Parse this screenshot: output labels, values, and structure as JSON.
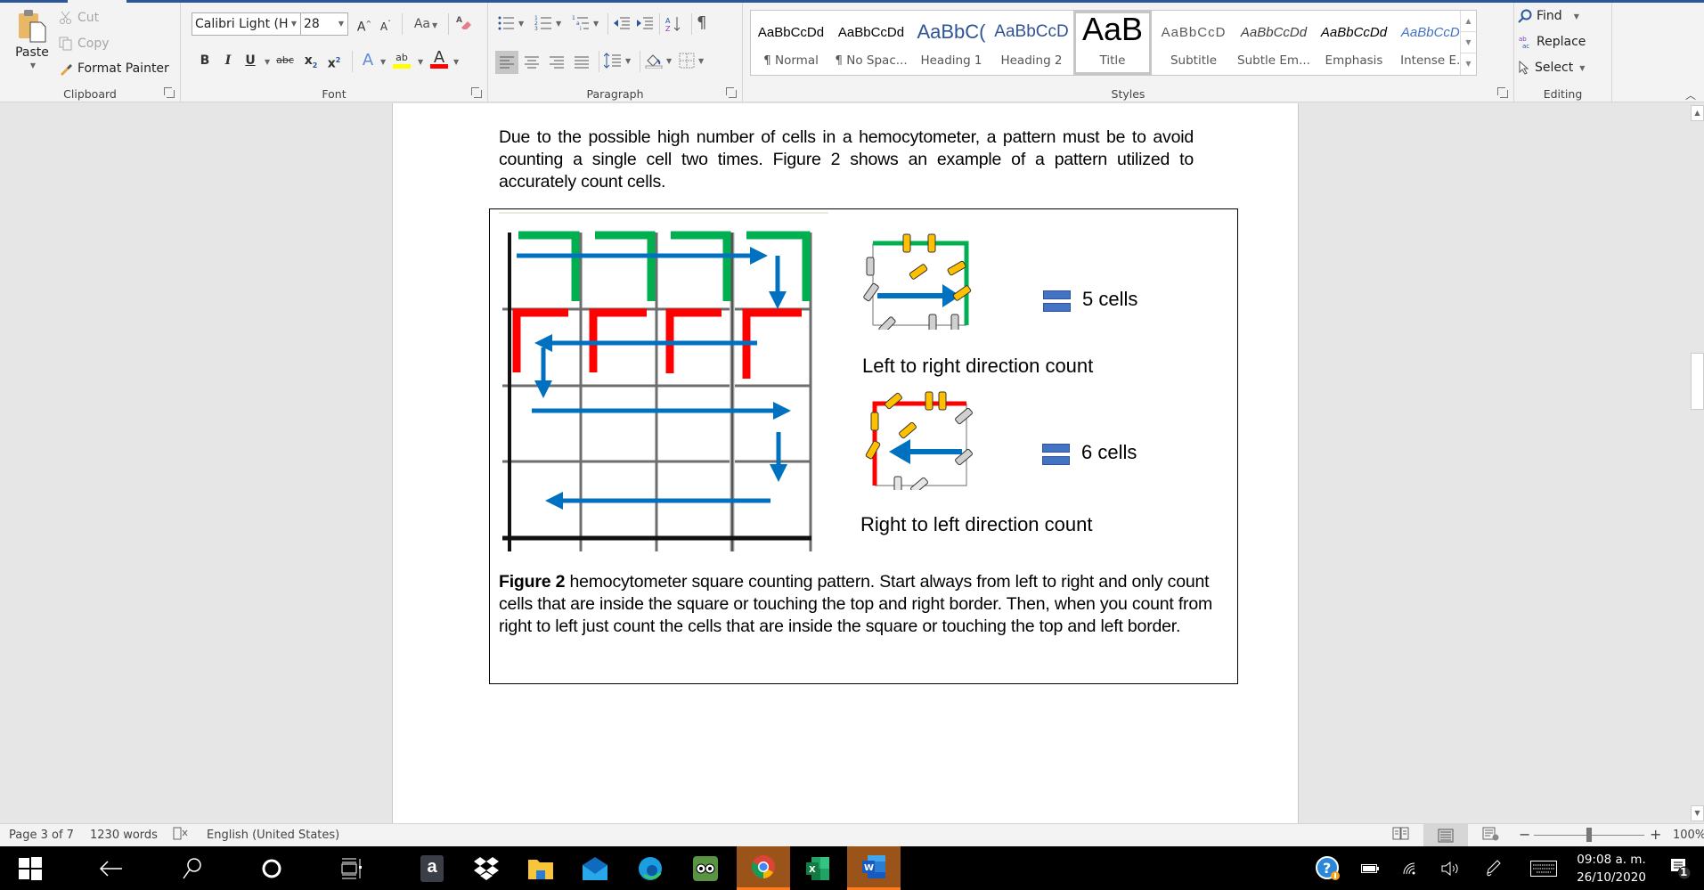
{
  "ribbon": {
    "clipboard": {
      "label": "Clipboard",
      "paste": "Paste",
      "cut": "Cut",
      "copy": "Copy",
      "format_painter": "Format Painter"
    },
    "font": {
      "label": "Font",
      "font_name": "Calibri Light (H",
      "font_size": "28",
      "grow": "A",
      "shrink": "A",
      "change_case": "Aa",
      "bold": "B",
      "italic": "I",
      "underline": "U",
      "strike": "abc",
      "subscript": "x",
      "superscript": "x",
      "text_effects": "A",
      "highlight": "ab",
      "font_color": "A",
      "highlight_color": "#ffff00",
      "font_color_value": "#ff0000"
    },
    "paragraph": {
      "label": "Paragraph",
      "show_marks": "¶"
    },
    "styles": {
      "label": "Styles",
      "items": [
        {
          "preview": "AaBbCcDd",
          "name": "¶ Normal"
        },
        {
          "preview": "AaBbCcDd",
          "name": "¶ No Spac..."
        },
        {
          "preview": "AaBbC(",
          "name": "Heading 1"
        },
        {
          "preview": "AaBbCcD",
          "name": "Heading 2"
        },
        {
          "preview": "AaB",
          "name": "Title"
        },
        {
          "preview": "AaBbCcD",
          "name": "Subtitle"
        },
        {
          "preview": "AaBbCcDd",
          "name": "Subtle Em..."
        },
        {
          "preview": "AaBbCcDd",
          "name": "Emphasis"
        },
        {
          "preview": "AaBbCcDd",
          "name": "Intense E..."
        }
      ],
      "selected": "Title"
    },
    "editing": {
      "label": "Editing",
      "find": "Find",
      "replace": "Replace",
      "select": "Select"
    }
  },
  "document": {
    "paragraph": "Due to the possible high number of cells in a hemocytometer, a pattern must be to avoid counting a single cell two times. Figure 2 shows an example of a pattern utilized to accurately count cells.",
    "figure": {
      "count_lr": "5 cells",
      "label_lr": "Left to right direction count",
      "count_rl": "6 cells",
      "label_rl": "Right to left direction count",
      "caption_bold": "Figure 2",
      "caption_text": " hemocytometer square counting pattern. Start always from left to right and only count cells that are inside the square or touching the top and right border. Then, when you count from right to left just count the cells that are inside the square or touching the top and left border.",
      "colors": {
        "green": "#00b050",
        "red": "#ff0000",
        "blue": "#0070c0",
        "counted_cell": "#ffc000",
        "uncounted_cell": "#d0d0d0",
        "equals": "#4472c4"
      }
    }
  },
  "status": {
    "page": "Page 3 of 7",
    "words": "1230 words",
    "language": "English (United States)",
    "zoom": "100%",
    "zoom_minus": "−",
    "zoom_plus": "+"
  },
  "taskbar": {
    "apps": [
      "Start",
      "Back",
      "Search",
      "Cortana",
      "Task View",
      "Amazon",
      "Dropbox",
      "File Explorer",
      "Mail",
      "Edge",
      "TripAdvisor",
      "Chrome",
      "Excel",
      "Word"
    ],
    "active": [
      "Chrome",
      "Word"
    ],
    "time": "09:08 a. m.",
    "date": "26/10/2020",
    "notifications": "1"
  }
}
